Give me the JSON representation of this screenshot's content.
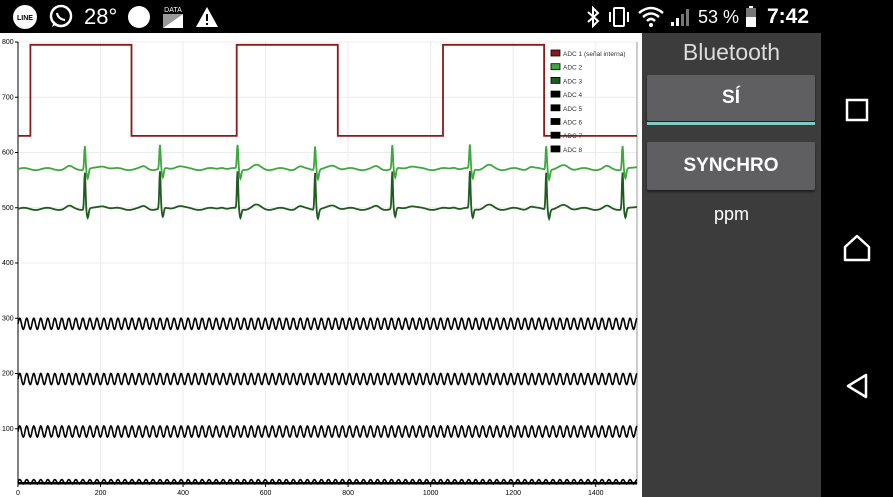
{
  "status_bar": {
    "icons_left": [
      "line-app-icon",
      "whatsapp-icon",
      "circle-icon",
      "data-saver-icon",
      "warning-icon"
    ],
    "temperature": "28°",
    "data_label": "DATA",
    "icons_right": [
      "bluetooth-icon",
      "vibrate-icon",
      "wifi-icon",
      "signal-icon",
      "battery-icon"
    ],
    "battery": "53 %",
    "time": "7:42"
  },
  "side": {
    "title": "Bluetooth",
    "si_label": "SÍ",
    "synchro_label": "SYNCHRO",
    "ppm_label": "ppm",
    "accent": "#80cbc4"
  },
  "nav": {
    "items": [
      "square-icon",
      "home-icon",
      "back-icon"
    ]
  },
  "chart_data": {
    "type": "line",
    "xlim": [
      0,
      1500
    ],
    "ylim": [
      0,
      800
    ],
    "x_ticks": [
      0,
      200,
      400,
      600,
      800,
      1000,
      1200,
      1400
    ],
    "y_ticks": [
      100,
      200,
      300,
      400,
      500,
      600,
      700,
      800
    ],
    "grid": true,
    "legend_position": "top-right",
    "series": [
      {
        "name": "ADC 1 (señal interna)",
        "color": "#8b1a1a",
        "kind": "square",
        "low": 630,
        "high": 795,
        "high_intervals": [
          [
            30,
            275
          ],
          [
            530,
            775
          ],
          [
            1030,
            1275
          ]
        ]
      },
      {
        "name": "ADC 2",
        "color": "#3da83d",
        "kind": "ecg",
        "baseline": 570,
        "peak": 613,
        "trough": 553,
        "beats": [
          162,
          344,
          532,
          720,
          907,
          1095,
          1280,
          1465
        ]
      },
      {
        "name": "ADC 3",
        "color": "#1f5a1f",
        "kind": "ecg",
        "baseline": 498,
        "peak": 565,
        "trough": 482,
        "beats": [
          162,
          344,
          532,
          720,
          907,
          1095,
          1280,
          1465
        ]
      },
      {
        "name": "ADC 4",
        "color": "#000000",
        "kind": "sine",
        "center": 290,
        "amplitude": 10
      },
      {
        "name": "ADC 5",
        "color": "#000000",
        "kind": "sine",
        "center": 190,
        "amplitude": 10
      },
      {
        "name": "ADC 6",
        "color": "#000000",
        "kind": "sine",
        "center": 95,
        "amplitude": 10
      },
      {
        "name": "ADC 7",
        "color": "#000000",
        "kind": "sine",
        "center": 4,
        "amplitude": 4
      },
      {
        "name": "ADC 8",
        "color": "#000000",
        "kind": "flat",
        "center": 2
      }
    ]
  }
}
